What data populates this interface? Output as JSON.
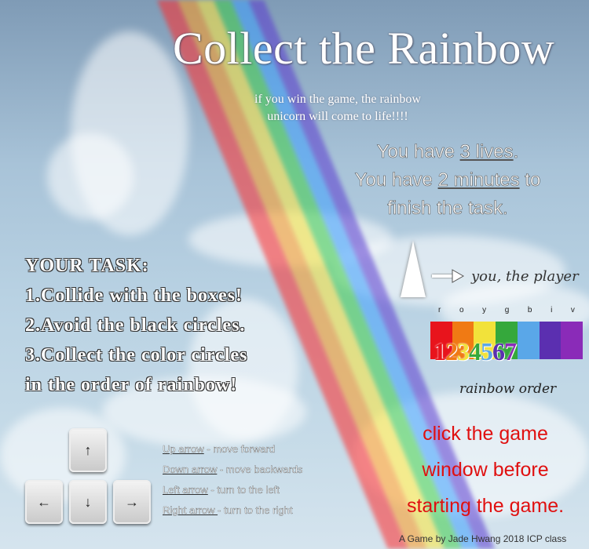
{
  "title": "Collect the Rainbow",
  "subtitle_line1": "if you win the game, the rainbow",
  "subtitle_line2": "unicorn will come to life!!!!",
  "lives": {
    "line1_pre": "You have ",
    "lives_count": "3 lives",
    "line1_post": ".",
    "line2_pre": "You have ",
    "minutes": "2 minutes",
    "line2_post": " to",
    "line3": "finish the task."
  },
  "task": {
    "heading": "YOUR TASK:",
    "items": [
      "1.Collide with the boxes!",
      "2.Avoid the black circles.",
      "3.Collect the color circles",
      "in the order of rainbow!"
    ]
  },
  "player_label": "you, the player",
  "rainbow_letters": [
    "r",
    "o",
    "y",
    "g",
    "b",
    "i",
    "v"
  ],
  "rainbow_digits": [
    "1",
    "2",
    "3",
    "4",
    "5",
    "6",
    "7"
  ],
  "rainbow_colors": [
    "#e8141c",
    "#f07a14",
    "#f2e23a",
    "#35a83c",
    "#5aa7e8",
    "#5b2fb0",
    "#8a2bb8"
  ],
  "rainbow_order_label": "rainbow order",
  "click_note": [
    "click the game",
    "window before",
    "starting the game."
  ],
  "keys": {
    "up": "↑",
    "down": "↓",
    "left": "←",
    "right": "→"
  },
  "controls": [
    {
      "key": "Up arrow",
      "desc": " - move forward"
    },
    {
      "key": "Down arrow",
      "desc": " - move backwards"
    },
    {
      "key": "Left arrow",
      "desc": " - turn to the left"
    },
    {
      "key": "Right arrow ",
      "desc": "- turn to the right"
    }
  ],
  "footer": "A Game by Jade Hwang 2018 ICP class"
}
